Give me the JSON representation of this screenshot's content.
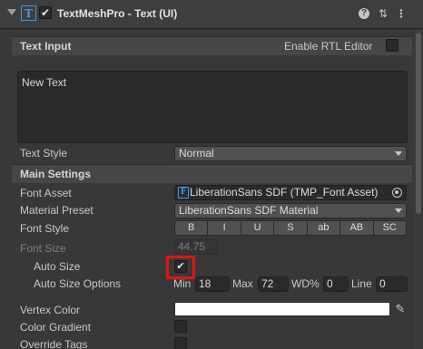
{
  "header": {
    "title": "TextMeshPro - Text (UI)",
    "enabled": true,
    "icons": [
      "help-icon",
      "preset-icon",
      "more-icon"
    ]
  },
  "text_input": {
    "section_title": "Text Input",
    "rtl_label": "Enable RTL Editor",
    "rtl_enabled": false,
    "text_value": "New Text"
  },
  "text_style": {
    "label": "Text Style",
    "value": "Normal"
  },
  "main_settings": {
    "section_title": "Main Settings",
    "font_asset_label": "Font Asset",
    "font_asset_value": "LiberationSans SDF (TMP_Font Asset)",
    "material_preset_label": "Material Preset",
    "material_preset_value": "LiberationSans SDF Material",
    "font_style_label": "Font Style",
    "font_style_buttons": [
      "B",
      "I",
      "U",
      "S",
      "ab",
      "AB",
      "SC"
    ],
    "font_size_label": "Font Size",
    "font_size_value": "44.75",
    "auto_size_label": "Auto Size",
    "auto_size_checked": true,
    "auto_size_options_label": "Auto Size Options",
    "min_label": "Min",
    "min_value": "18",
    "max_label": "Max",
    "max_value": "72",
    "wd_label": "WD%",
    "wd_value": "0",
    "line_label": "Line",
    "line_value": "0",
    "vertex_color_label": "Vertex Color",
    "vertex_color": "#ffffff",
    "color_gradient_label": "Color Gradient",
    "color_gradient_checked": false,
    "override_tags_label": "Override Tags",
    "override_tags_checked": false
  },
  "colors": {
    "accent": "#3d9ae6",
    "highlight": "#e21414"
  }
}
